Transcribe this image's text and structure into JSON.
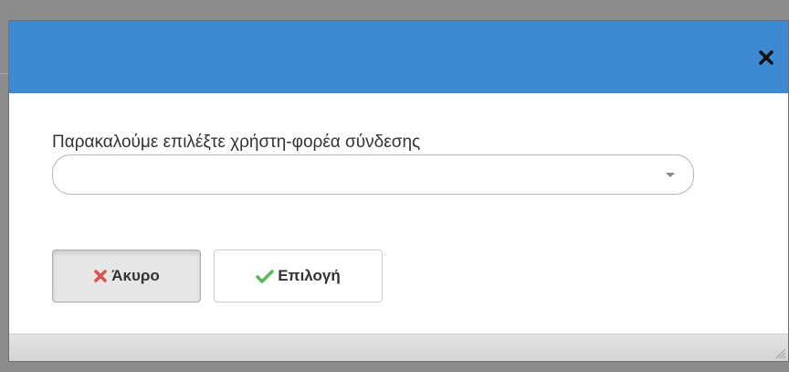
{
  "dialog": {
    "close_icon": "close-icon",
    "prompt_label": "Παρακαλούμε επιλέξτε χρήστη-φορέα σύνδεσης",
    "select": {
      "selected_value": "",
      "arrow_icon": "chevron-down-icon"
    },
    "buttons": {
      "cancel_label": "Άκυρο",
      "cancel_icon": "x-icon",
      "select_label": "Επιλογή",
      "select_icon": "check-icon"
    }
  },
  "colors": {
    "header": "#3d8ad2",
    "cancel_icon": "#d9534f",
    "check_icon": "#5cb85c"
  }
}
